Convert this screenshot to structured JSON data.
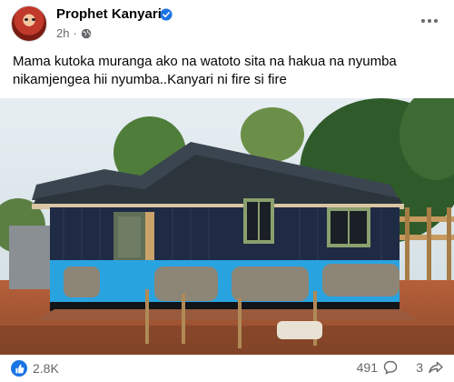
{
  "post": {
    "author": "Prophet Kanyari",
    "time": "2h",
    "text": "Mama kutoka muranga ako na watoto sita na hakua na nyumba nikamjengea hii nyumba..Kanyari ni fire si fire",
    "icons": {
      "verified": "verified-badge-icon",
      "audience": "globe-icon",
      "more": "more-options-icon"
    }
  },
  "reactions": {
    "likes": "2.8K",
    "comments": "491",
    "shares": "3"
  },
  "colors": {
    "brand": "#1b74e4",
    "muted": "#65676b",
    "house_wall": "#1f2a44",
    "house_trim_blue": "#29a3e0"
  }
}
